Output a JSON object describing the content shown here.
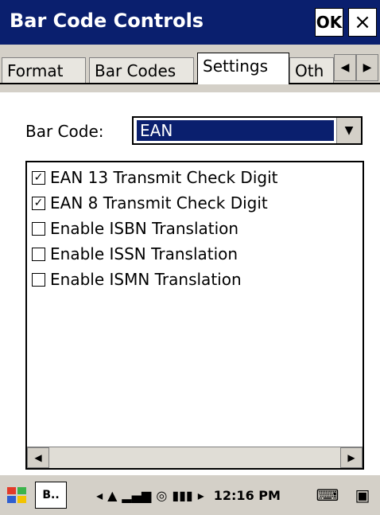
{
  "window": {
    "title": "Bar Code Controls",
    "ok_label": "OK",
    "close_label": "×"
  },
  "tabs": [
    "Format",
    "Bar Codes",
    "Settings",
    "Oth"
  ],
  "tab_scroll": {
    "left": "◀",
    "right": "▶"
  },
  "barcode": {
    "label": "Bar Code:",
    "selected": "EAN",
    "dropdown_icon": "▼"
  },
  "options": [
    {
      "label": "EAN 13 Transmit Check Digit",
      "checked": true
    },
    {
      "label": "EAN 8 Transmit Check Digit",
      "checked": true
    },
    {
      "label": "Enable ISBN Translation",
      "checked": false
    },
    {
      "label": "Enable ISSN Translation",
      "checked": false
    },
    {
      "label": "Enable ISMN Translation",
      "checked": false
    }
  ],
  "scroll": {
    "left": "◀",
    "right": "▶"
  },
  "taskbar": {
    "start_icon": "windows-logo",
    "task_label": "B..",
    "clock": "12:16 PM",
    "keyboard_icon": "keyboard-icon",
    "window_icon": "window-switcher-icon"
  }
}
